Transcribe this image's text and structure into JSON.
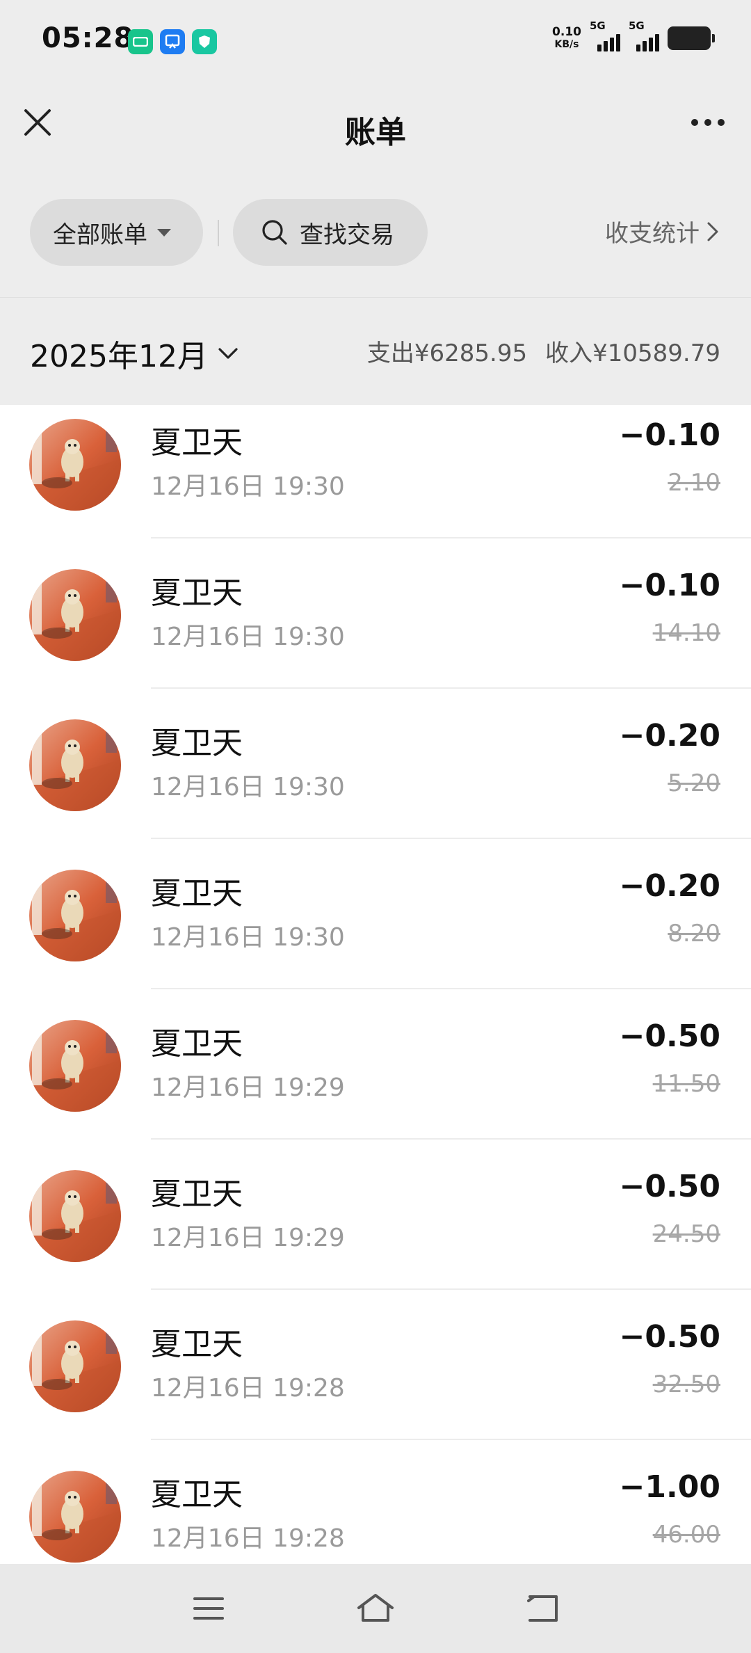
{
  "status_bar": {
    "time": "05:28",
    "net_speed_value": "0.10",
    "net_speed_unit": "KB/s",
    "signal_1_label": "5G",
    "signal_2_label": "5G"
  },
  "header": {
    "title": "账单"
  },
  "filters": {
    "all_bills_label": "全部账单",
    "search_label": "查找交易",
    "stats_label": "收支统计"
  },
  "month": {
    "label": "2025年12月",
    "expense": "支出¥6285.95",
    "income": "收入¥10589.79"
  },
  "transactions": [
    {
      "name": "夏卫天",
      "time": "12月16日 19:30",
      "amount": "−0.10",
      "balance": "2.10"
    },
    {
      "name": "夏卫天",
      "time": "12月16日 19:30",
      "amount": "−0.10",
      "balance": "14.10"
    },
    {
      "name": "夏卫天",
      "time": "12月16日 19:30",
      "amount": "−0.20",
      "balance": "5.20"
    },
    {
      "name": "夏卫天",
      "time": "12月16日 19:30",
      "amount": "−0.20",
      "balance": "8.20"
    },
    {
      "name": "夏卫天",
      "time": "12月16日 19:29",
      "amount": "−0.50",
      "balance": "11.50"
    },
    {
      "name": "夏卫天",
      "time": "12月16日 19:29",
      "amount": "−0.50",
      "balance": "24.50"
    },
    {
      "name": "夏卫天",
      "time": "12月16日 19:28",
      "amount": "−0.50",
      "balance": "32.50"
    },
    {
      "name": "夏卫天",
      "time": "12月16日 19:28",
      "amount": "−1.00",
      "balance": "46.00"
    }
  ],
  "colors": {
    "background": "#ededed",
    "pill": "#dcdcdc",
    "avatar_ground": "#d9613a"
  },
  "icons": [
    "close-icon",
    "more-icon",
    "dropdown-caret-icon",
    "search-icon",
    "chevron-right-icon",
    "chevron-down-icon",
    "menu-icon",
    "home-icon",
    "back-icon"
  ]
}
